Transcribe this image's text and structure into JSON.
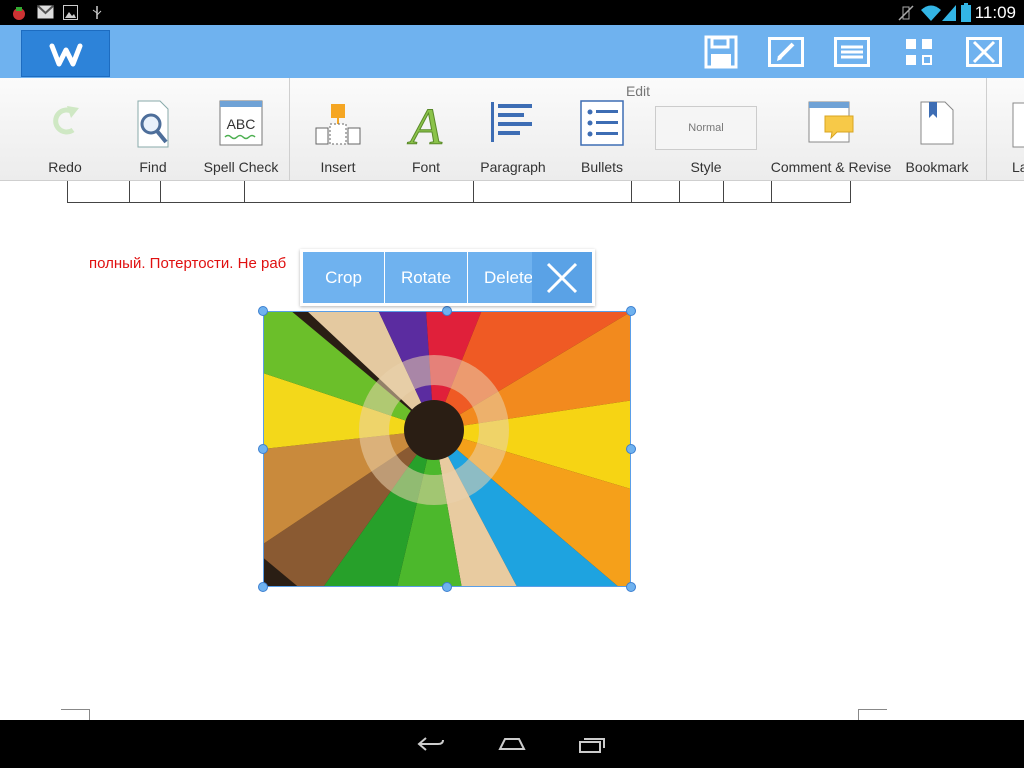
{
  "status_bar": {
    "time": "11:09",
    "left_icons": [
      "app-notification-icon",
      "gmail-icon",
      "gallery-icon",
      "usb-icon"
    ],
    "right_icons": [
      "vibrate-mute-icon",
      "wifi-icon",
      "signal-icon",
      "battery-icon"
    ]
  },
  "app_bar": {
    "logo_letter": "W",
    "actions": [
      "save-icon",
      "edit-icon",
      "list-icon",
      "grid-icon",
      "close-icon"
    ]
  },
  "ribbon": {
    "group_title": "Edit",
    "items": [
      {
        "label": "Redo",
        "icon": "redo-icon"
      },
      {
        "label": "Find",
        "icon": "find-icon"
      },
      {
        "label": "Spell Check",
        "icon": "spell-check-icon",
        "icon_text": "ABC"
      },
      {
        "label": "Insert",
        "icon": "insert-icon"
      },
      {
        "label": "Font",
        "icon": "font-icon",
        "icon_text": "A"
      },
      {
        "label": "Paragraph",
        "icon": "paragraph-icon"
      },
      {
        "label": "Bullets",
        "icon": "bullets-icon"
      },
      {
        "label": "Style",
        "icon": "style-icon",
        "icon_text": "Normal"
      },
      {
        "label": "Comment & Revise",
        "icon": "comment-icon"
      },
      {
        "label": "Bookmark",
        "icon": "bookmark-icon"
      },
      {
        "label": "La",
        "icon": "layout-icon"
      }
    ]
  },
  "document": {
    "text_line": "полный. Потертости. Не раб"
  },
  "context_menu": {
    "crop": "Crop",
    "rotate": "Rotate",
    "delete": "Delete"
  },
  "colors": {
    "accent": "#6fb2ef",
    "logo": "#2d83d9",
    "red_text": "#e01010"
  }
}
